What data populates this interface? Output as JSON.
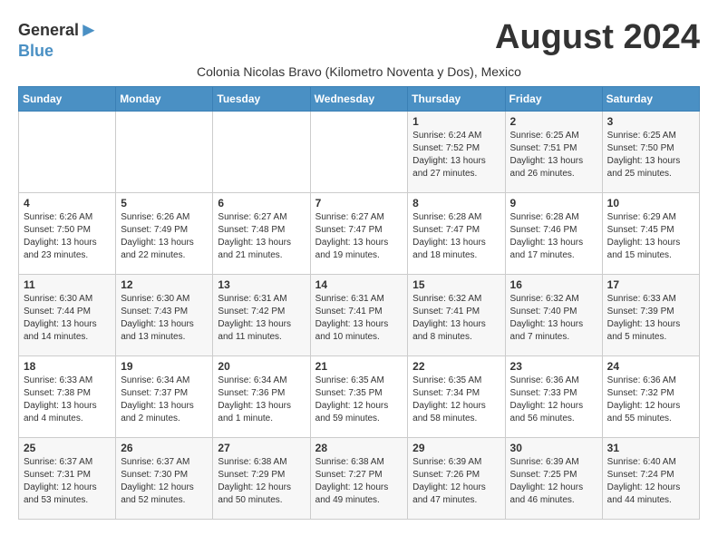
{
  "logo": {
    "general": "General",
    "blue": "Blue"
  },
  "title": "August 2024",
  "subtitle": "Colonia Nicolas Bravo (Kilometro Noventa y Dos), Mexico",
  "days_of_week": [
    "Sunday",
    "Monday",
    "Tuesday",
    "Wednesday",
    "Thursday",
    "Friday",
    "Saturday"
  ],
  "weeks": [
    [
      {
        "day": "",
        "info": ""
      },
      {
        "day": "",
        "info": ""
      },
      {
        "day": "",
        "info": ""
      },
      {
        "day": "",
        "info": ""
      },
      {
        "day": "1",
        "info": "Sunrise: 6:24 AM\nSunset: 7:52 PM\nDaylight: 13 hours and 27 minutes."
      },
      {
        "day": "2",
        "info": "Sunrise: 6:25 AM\nSunset: 7:51 PM\nDaylight: 13 hours and 26 minutes."
      },
      {
        "day": "3",
        "info": "Sunrise: 6:25 AM\nSunset: 7:50 PM\nDaylight: 13 hours and 25 minutes."
      }
    ],
    [
      {
        "day": "4",
        "info": "Sunrise: 6:26 AM\nSunset: 7:50 PM\nDaylight: 13 hours and 23 minutes."
      },
      {
        "day": "5",
        "info": "Sunrise: 6:26 AM\nSunset: 7:49 PM\nDaylight: 13 hours and 22 minutes."
      },
      {
        "day": "6",
        "info": "Sunrise: 6:27 AM\nSunset: 7:48 PM\nDaylight: 13 hours and 21 minutes."
      },
      {
        "day": "7",
        "info": "Sunrise: 6:27 AM\nSunset: 7:47 PM\nDaylight: 13 hours and 19 minutes."
      },
      {
        "day": "8",
        "info": "Sunrise: 6:28 AM\nSunset: 7:47 PM\nDaylight: 13 hours and 18 minutes."
      },
      {
        "day": "9",
        "info": "Sunrise: 6:28 AM\nSunset: 7:46 PM\nDaylight: 13 hours and 17 minutes."
      },
      {
        "day": "10",
        "info": "Sunrise: 6:29 AM\nSunset: 7:45 PM\nDaylight: 13 hours and 15 minutes."
      }
    ],
    [
      {
        "day": "11",
        "info": "Sunrise: 6:30 AM\nSunset: 7:44 PM\nDaylight: 13 hours and 14 minutes."
      },
      {
        "day": "12",
        "info": "Sunrise: 6:30 AM\nSunset: 7:43 PM\nDaylight: 13 hours and 13 minutes."
      },
      {
        "day": "13",
        "info": "Sunrise: 6:31 AM\nSunset: 7:42 PM\nDaylight: 13 hours and 11 minutes."
      },
      {
        "day": "14",
        "info": "Sunrise: 6:31 AM\nSunset: 7:41 PM\nDaylight: 13 hours and 10 minutes."
      },
      {
        "day": "15",
        "info": "Sunrise: 6:32 AM\nSunset: 7:41 PM\nDaylight: 13 hours and 8 minutes."
      },
      {
        "day": "16",
        "info": "Sunrise: 6:32 AM\nSunset: 7:40 PM\nDaylight: 13 hours and 7 minutes."
      },
      {
        "day": "17",
        "info": "Sunrise: 6:33 AM\nSunset: 7:39 PM\nDaylight: 13 hours and 5 minutes."
      }
    ],
    [
      {
        "day": "18",
        "info": "Sunrise: 6:33 AM\nSunset: 7:38 PM\nDaylight: 13 hours and 4 minutes."
      },
      {
        "day": "19",
        "info": "Sunrise: 6:34 AM\nSunset: 7:37 PM\nDaylight: 13 hours and 2 minutes."
      },
      {
        "day": "20",
        "info": "Sunrise: 6:34 AM\nSunset: 7:36 PM\nDaylight: 13 hours and 1 minute."
      },
      {
        "day": "21",
        "info": "Sunrise: 6:35 AM\nSunset: 7:35 PM\nDaylight: 12 hours and 59 minutes."
      },
      {
        "day": "22",
        "info": "Sunrise: 6:35 AM\nSunset: 7:34 PM\nDaylight: 12 hours and 58 minutes."
      },
      {
        "day": "23",
        "info": "Sunrise: 6:36 AM\nSunset: 7:33 PM\nDaylight: 12 hours and 56 minutes."
      },
      {
        "day": "24",
        "info": "Sunrise: 6:36 AM\nSunset: 7:32 PM\nDaylight: 12 hours and 55 minutes."
      }
    ],
    [
      {
        "day": "25",
        "info": "Sunrise: 6:37 AM\nSunset: 7:31 PM\nDaylight: 12 hours and 53 minutes."
      },
      {
        "day": "26",
        "info": "Sunrise: 6:37 AM\nSunset: 7:30 PM\nDaylight: 12 hours and 52 minutes."
      },
      {
        "day": "27",
        "info": "Sunrise: 6:38 AM\nSunset: 7:29 PM\nDaylight: 12 hours and 50 minutes."
      },
      {
        "day": "28",
        "info": "Sunrise: 6:38 AM\nSunset: 7:27 PM\nDaylight: 12 hours and 49 minutes."
      },
      {
        "day": "29",
        "info": "Sunrise: 6:39 AM\nSunset: 7:26 PM\nDaylight: 12 hours and 47 minutes."
      },
      {
        "day": "30",
        "info": "Sunrise: 6:39 AM\nSunset: 7:25 PM\nDaylight: 12 hours and 46 minutes."
      },
      {
        "day": "31",
        "info": "Sunrise: 6:40 AM\nSunset: 7:24 PM\nDaylight: 12 hours and 44 minutes."
      }
    ]
  ]
}
